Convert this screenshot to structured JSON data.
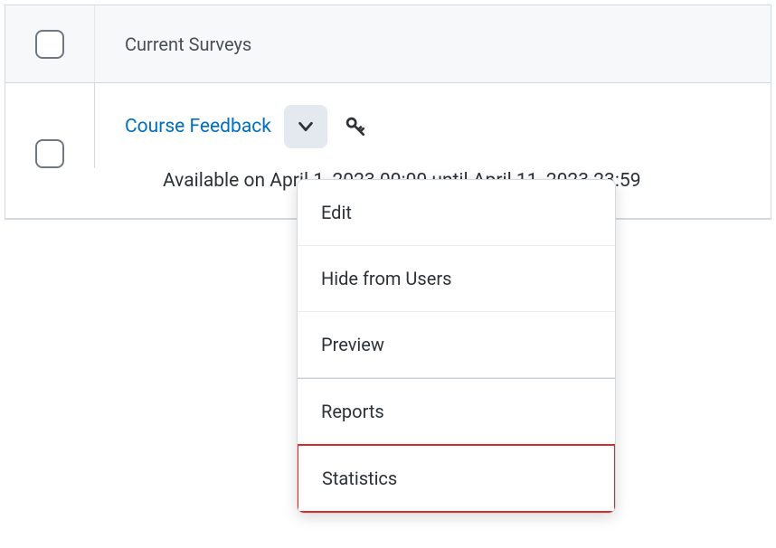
{
  "header": {
    "title": "Current Surveys"
  },
  "item": {
    "link_label": "Course Feedback",
    "availability_text": "Available on April 1, 2023 00:00 until April 11, 2023 23:59"
  },
  "dropdown": {
    "items": [
      {
        "label": "Edit"
      },
      {
        "label": "Hide from Users"
      },
      {
        "label": "Preview"
      },
      {
        "label": "Reports"
      },
      {
        "label": "Statistics"
      }
    ]
  },
  "colors": {
    "link": "#006fbf",
    "highlight": "#d92b2b"
  }
}
